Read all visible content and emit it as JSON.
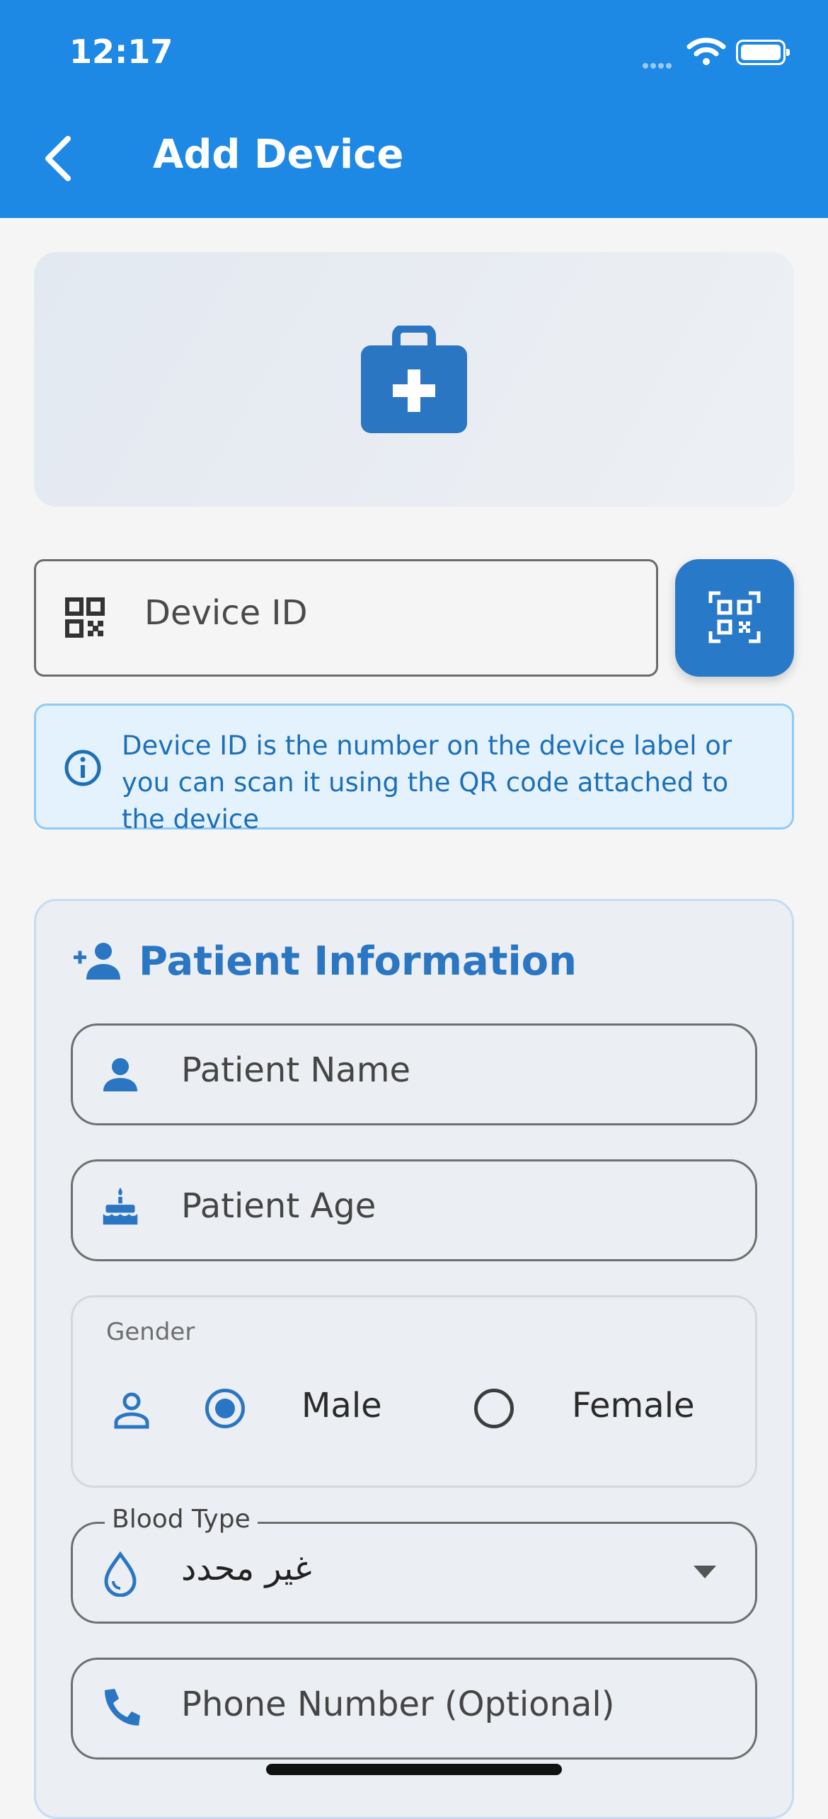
{
  "status_bar": {
    "time": "12:17"
  },
  "header": {
    "title": "Add Device",
    "back_icon": "chevron-left-icon"
  },
  "banner": {
    "icon": "medical-kit-icon"
  },
  "device": {
    "placeholder": "Device ID",
    "field_icon": "qr-code-icon",
    "scan_button_icon": "qr-scan-icon",
    "info_text": "Device ID is the number on the device label or you can scan it using the QR code attached to the device"
  },
  "patient": {
    "title": "Patient Information",
    "title_icon": "person-add-icon",
    "name_placeholder": "Patient Name",
    "age_placeholder": "Patient Age",
    "gender": {
      "label": "Gender",
      "options": [
        "Male",
        "Female"
      ],
      "selected": "Male"
    },
    "blood_type": {
      "label": "Blood Type",
      "value": "غير محدد"
    },
    "phone_placeholder": "Phone Number (Optional)"
  },
  "colors": {
    "primary": "#1e88e5",
    "accent": "#2a76c2",
    "info_bg": "#e3f2fd",
    "info_border": "#90caf9"
  }
}
